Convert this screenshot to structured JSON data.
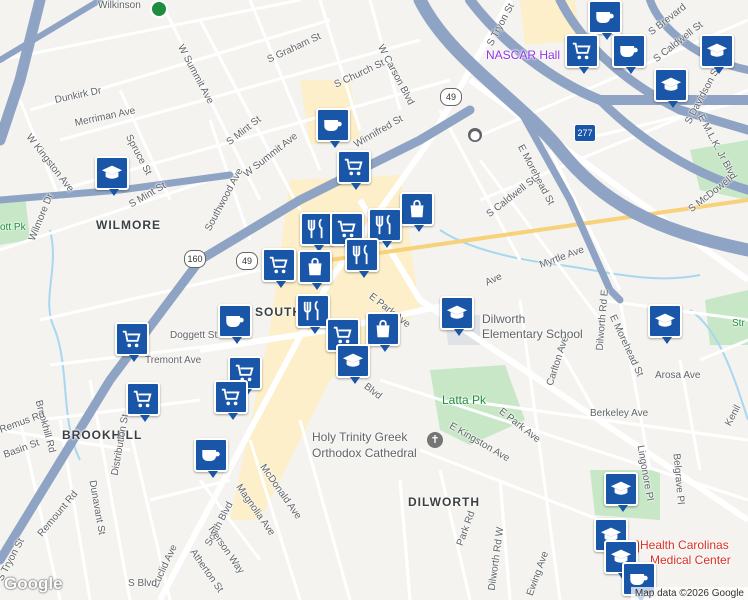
{
  "map": {
    "area_labels": [
      "WILMORE",
      "SOUTH",
      "BROOKHILL",
      "DILWORTH"
    ],
    "street_labels": {
      "wilkinson": "Wilkinson",
      "w_summit_ave_top": "W Summit Ave",
      "s_graham_st": "S Graham St",
      "s_church_st": "S Church St",
      "w_carson_blvd": "W Carson Blvd",
      "s_tryon_top": "S Tryon St",
      "s_brevard": "S Brevard",
      "s_caldwell_top": "S Caldwell St",
      "dunkirk_dr": "Dunkirk Dr",
      "w_kingston_ave": "W Kingston Ave",
      "merriman_ave": "Merriman Ave",
      "spruce_st": "Spruce St",
      "s_mint_st": "S Mint St",
      "s_mint_st_2": "S Mint St",
      "w_summit_ave": "W Summit Ave",
      "southwood_ave": "Southwood Ave",
      "wilmore_dr": "Wilmore Dr",
      "winnifred_st": "Winnifred St",
      "e_morehead_st": "E Morehead St",
      "s_caldwell_st": "S Caldwell St",
      "s_mcdowell": "S McDowell",
      "s_davidson": "S Davidson St",
      "e_mlk": "E M.L.K. Jr Blvd",
      "doggett_st": "Doggett St",
      "tremont_ave": "Tremont Ave",
      "e_park_ave": "E Park Ave",
      "myrtle_ave": "Myrtle Ave",
      "e_morehead_2": "E Morehead St",
      "dilworth_rd_e": "Dilworth Rd E",
      "carlton_ave": "Carlton Ave",
      "arosa_ave": "Arosa Ave",
      "berkeley_ave": "Berkeley Ave",
      "e_park_ave_2": "E Park Ave",
      "e_kingston_ave": "E Kingston Ave",
      "lingonore_pl": "Lingonore Pl",
      "belgrave_pl": "Belgrave Pl",
      "brookhill_rd": "Brookhill Rd",
      "remus_rd": "Remus Rd",
      "basin_st": "Basin St",
      "dunavant_st": "Dunavant St",
      "distribution_st": "Distribution St",
      "remount_rd": "Remount Rd",
      "s_tryon_st": "S Tryon St",
      "south_blvd": "South Blvd",
      "mcdonald_ave": "McDonald Ave",
      "magnolia_ave": "Magnolia Ave",
      "iverson_way": "Iverson Way",
      "atherton_st": "Atherton St",
      "euclid_ave": "Euclid Ave",
      "park_rd": "Park Rd",
      "dilworth_rd_w": "Dilworth Rd W",
      "ewing_ave": "Ewing Ave",
      "blvd_fragment": "Blvd",
      "ave_fragment": "Ave",
      "s_blvd_bottom": "S Blvd",
      "kenil": "Kenil",
      "pk_fragment": "ott Pk",
      "st_fragment": "Str"
    },
    "poi_labels": {
      "nascar": "NASCAR Hall",
      "dilworth_school_1": "Dilworth",
      "dilworth_school_2": "Elementary School",
      "latta_park": "Latta Pk",
      "holy_trinity_1": "Holy Trinity Greek",
      "holy_trinity_2": "Orthodox Cathedral",
      "health_1": "Health Carolinas",
      "health_2": "Medical Center"
    },
    "highway_shields": [
      "49",
      "49",
      "160",
      "277"
    ],
    "pins": [
      {
        "type": "cafe"
      },
      {
        "type": "shopping-cart"
      },
      {
        "type": "school"
      },
      {
        "type": "cafe"
      },
      {
        "type": "school"
      },
      {
        "type": "school"
      },
      {
        "type": "school"
      },
      {
        "type": "school"
      },
      {
        "type": "cafe"
      },
      {
        "type": "shopping-cart"
      },
      {
        "type": "shopping-cart"
      },
      {
        "type": "restaurant"
      },
      {
        "type": "shopping-bag"
      },
      {
        "type": "restaurant"
      },
      {
        "type": "shopping-cart"
      },
      {
        "type": "shopping-bag"
      },
      {
        "type": "restaurant"
      },
      {
        "type": "cafe"
      },
      {
        "type": "restaurant"
      },
      {
        "type": "shopping-cart"
      },
      {
        "type": "shopping-bag"
      },
      {
        "type": "school"
      },
      {
        "type": "shopping-cart"
      },
      {
        "type": "shopping-cart"
      },
      {
        "type": "shopping-cart"
      },
      {
        "type": "cafe"
      },
      {
        "type": "school"
      },
      {
        "type": "school"
      },
      {
        "type": "school"
      },
      {
        "type": "cafe"
      }
    ],
    "attribution": {
      "logo": "Google",
      "copyright": "Map data ©2026 Google"
    },
    "colors": {
      "background": "#f4f3ef",
      "highway": "#8fa4c4",
      "arterial": "#ffffff",
      "park": "#c7e7c6",
      "water": "#a8d8f0",
      "pin": "#1a56a8",
      "commercial": "#fcefc9"
    }
  }
}
